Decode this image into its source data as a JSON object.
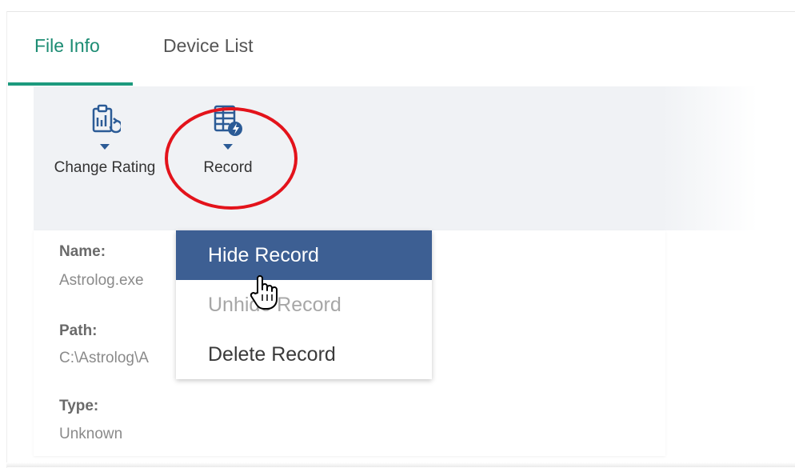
{
  "tabs": [
    {
      "label": "File Info",
      "active": true
    },
    {
      "label": "Device List",
      "active": false
    }
  ],
  "toolbar": {
    "change_rating": {
      "label": "Change Rating",
      "icon": "clipboard-refresh-icon"
    },
    "record": {
      "label": "Record",
      "icon": "list-bolt-icon"
    }
  },
  "info": {
    "name": {
      "label": "Name:",
      "value": "Astrolog.exe"
    },
    "path": {
      "label": "Path:",
      "value": "C:\\Astrolog\\A"
    },
    "type": {
      "label": "Type:",
      "value": "Unknown"
    }
  },
  "record_menu": {
    "items": [
      {
        "label": "Hide Record",
        "state": "highlighted"
      },
      {
        "label": "Unhide Record",
        "state": "disabled"
      },
      {
        "label": "Delete Record",
        "state": "enabled"
      }
    ]
  },
  "colors": {
    "accent": "#1c9a7e",
    "menu_highlight": "#3d5f93",
    "callout": "#e3131b",
    "toolbar_bg": "#f0f2f5"
  }
}
